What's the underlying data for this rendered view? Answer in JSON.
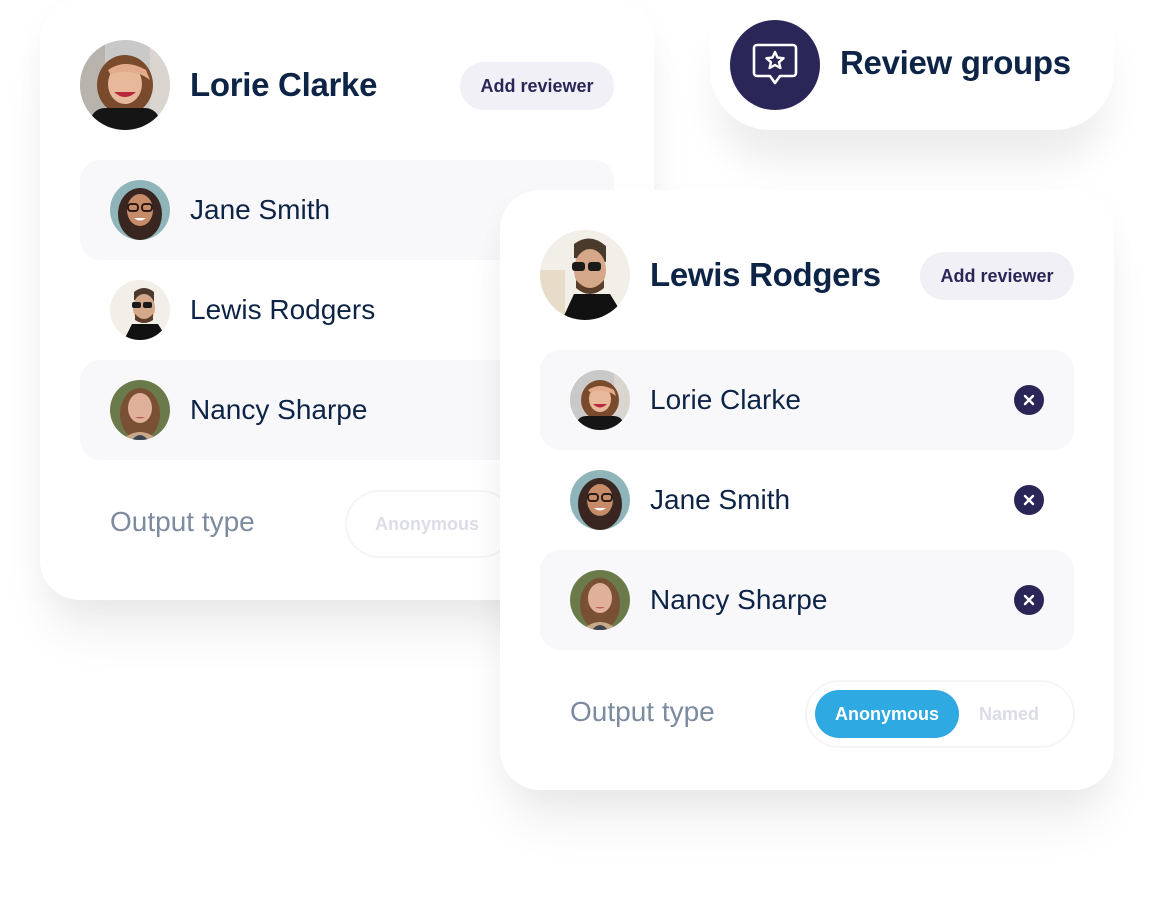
{
  "review_groups": {
    "title": "Review groups",
    "icon": "star-message-icon"
  },
  "colors": {
    "navy": "#2a2658",
    "text_dark": "#0d2446",
    "muted_label": "#7d8ba0",
    "accent_blue": "#2ea9e2",
    "row_shade": "#f8f8fb",
    "button_bg": "#f0f0f6",
    "inactive_option": "#dcdce6"
  },
  "left_card": {
    "owner": "Lorie Clarke",
    "add_reviewer_label": "Add reviewer",
    "reviewers": [
      {
        "name": "Jane Smith",
        "shaded": true
      },
      {
        "name": "Lewis Rodgers",
        "shaded": false
      },
      {
        "name": "Nancy Sharpe",
        "shaded": true
      }
    ],
    "output_type_label": "Output type",
    "output_options": [
      "Anonymous"
    ],
    "selected_option": ""
  },
  "right_card": {
    "owner": "Lewis Rodgers",
    "add_reviewer_label": "Add reviewer",
    "reviewers": [
      {
        "name": "Lorie Clarke",
        "shaded": true
      },
      {
        "name": "Jane Smith",
        "shaded": false
      },
      {
        "name": "Nancy Sharpe",
        "shaded": true
      }
    ],
    "output_type_label": "Output type",
    "output_options": [
      "Anonymous",
      "Named"
    ],
    "selected_option": "Anonymous"
  }
}
